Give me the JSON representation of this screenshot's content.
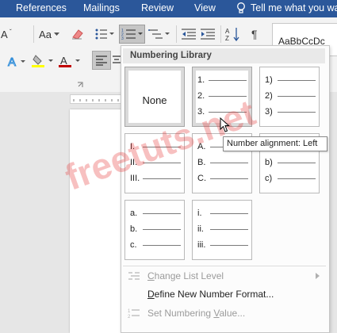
{
  "tabs": {
    "references": "References",
    "mailings": "Mailings",
    "review": "Review",
    "view": "View",
    "tell_me": "Tell me what you wa"
  },
  "ribbon": {
    "change_case": "Aa",
    "style_sample": "AaBbCcDc",
    "font_color": "#c00000",
    "highlight_color": "#ffff00",
    "accent": "#2b579a"
  },
  "numbering": {
    "header": "Numbering Library",
    "none_label": "None",
    "formats": [
      {
        "markers": [
          "1.",
          "2.",
          "3."
        ]
      },
      {
        "markers": [
          "1)",
          "2)",
          "3)"
        ]
      },
      {
        "markers": [
          "I.",
          "II.",
          "III."
        ]
      },
      {
        "markers": [
          "A.",
          "B.",
          "C."
        ]
      },
      {
        "markers": [
          "a)",
          "b)",
          "c)"
        ]
      },
      {
        "markers": [
          "a.",
          "b.",
          "c."
        ]
      },
      {
        "markers": [
          "i.",
          "ii.",
          "iii."
        ]
      }
    ],
    "tooltip": "Number alignment: Left"
  },
  "menu": {
    "change_level": {
      "pre": "",
      "u": "C",
      "post": "hange List Level"
    },
    "define_format": {
      "pre": "",
      "u": "D",
      "post": "efine New Number Format..."
    },
    "set_value": {
      "pre": "Set Numbering ",
      "u": "V",
      "post": "alue..."
    }
  },
  "watermark": "freetuts.net"
}
